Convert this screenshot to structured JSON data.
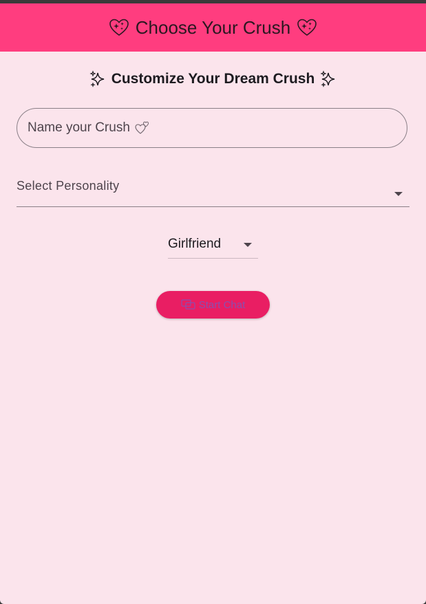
{
  "app_bar": {
    "title": "Choose Your Crush",
    "left_icon": "sparkling-heart-icon",
    "right_icon": "sparkling-heart-icon",
    "background": "#ff3d7f"
  },
  "subtitle": {
    "text": "Customize Your Dream Crush",
    "left_icon": "sparkles-icon",
    "right_icon": "sparkles-icon"
  },
  "name_input": {
    "placeholder": "Name your Crush",
    "value": "",
    "trailing_icon": "two-hearts-icon"
  },
  "personality_dropdown": {
    "label": "Select Personality",
    "selected": ""
  },
  "role_dropdown": {
    "selected": "Girlfriend"
  },
  "start_button": {
    "label": "Start Chat",
    "icon": "chat-icon",
    "background": "#e91e63"
  },
  "colors": {
    "page_background": "#fbe4ec",
    "accent": "#ff3d7f"
  }
}
